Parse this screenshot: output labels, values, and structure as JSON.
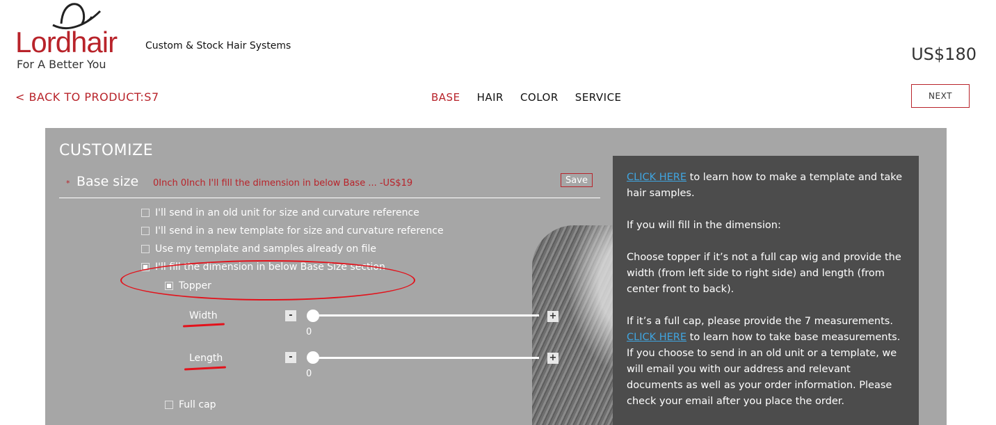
{
  "header": {
    "logo_word": "Lordhair",
    "logo_tagline": "For A Better You",
    "tagline": "Custom & Stock Hair Systems",
    "price": "US$180"
  },
  "nav": {
    "back_label": "< BACK TO PRODUCT:S7",
    "steps": [
      {
        "label": "BASE",
        "active": true
      },
      {
        "label": "HAIR",
        "active": false
      },
      {
        "label": "COLOR",
        "active": false
      },
      {
        "label": "SERVICE",
        "active": false
      }
    ],
    "next_label": "NEXT"
  },
  "customize": {
    "title": "CUSTOMIZE",
    "base_size": {
      "required_marker": "*",
      "label": "Base size",
      "summary": "0Inch 0Inch I'll fill the dimension in below Base ... -US$19",
      "save_label": "Save"
    },
    "options": [
      {
        "label": "I'll send in an old unit for size and curvature reference",
        "checked": false
      },
      {
        "label": "I'll send in a new template for size and curvature reference",
        "checked": false
      },
      {
        "label": "Use my template and samples already on file",
        "checked": false
      },
      {
        "label": "I'll fill the dimension in below Base Size section",
        "checked": true
      }
    ],
    "topper": {
      "label": "Topper",
      "checked": true
    },
    "width": {
      "label": "Width",
      "minus": "-",
      "plus": "+",
      "value": "0"
    },
    "length": {
      "label": "Length",
      "minus": "-",
      "plus": "+",
      "value": "0"
    },
    "full_cap": {
      "label": "Full cap",
      "checked": false
    }
  },
  "info": {
    "link1": "CLICK HERE",
    "text1": " to learn how to make a template and take hair samples.",
    "text2": "If you will fill in the dimension:",
    "text3": "Choose topper if it’s not a full cap wig and provide the width (from left side to right side) and length (from center front to back).",
    "text4": "If it’s a full cap, please provide the 7 measurements.",
    "link2": "CLICK HERE",
    "text5": " to learn how to take base measurements. If you choose to send in an old unit or a template, we will email you with our address and relevant documents as well as your order information. Please check your email after you place the order."
  },
  "colors": {
    "brand_red": "#b8232a",
    "annotation_red": "#e3121b",
    "panel_gray": "#a6a6a6",
    "info_bg": "#4c4c4c",
    "link_blue": "#40a5e0"
  }
}
